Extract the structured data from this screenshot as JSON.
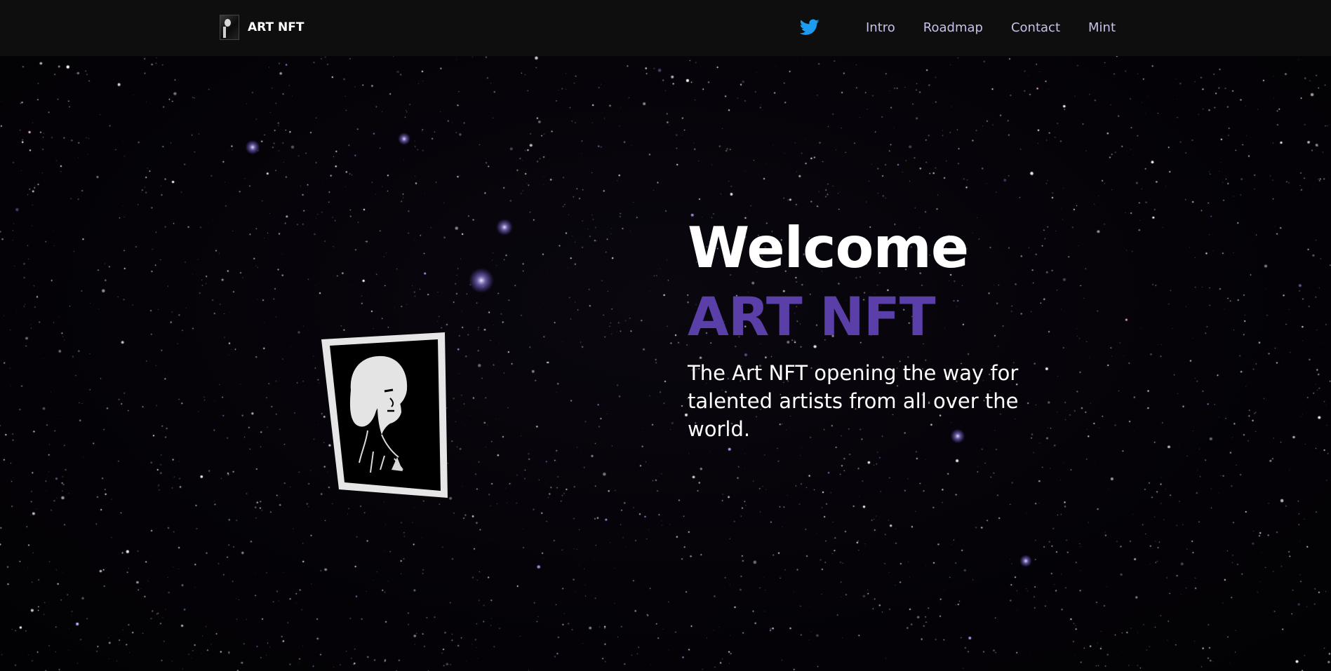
{
  "brand": {
    "name": "ART NFT",
    "logo_icon": "portrait-logo-icon"
  },
  "nav": {
    "twitter_icon": "twitter-icon",
    "twitter_color": "#1d9bf0",
    "links": [
      {
        "label": "Intro"
      },
      {
        "label": "Roadmap"
      },
      {
        "label": "Contact"
      },
      {
        "label": "Mint"
      }
    ]
  },
  "hero": {
    "title": "Welcome",
    "subtitle": "ART NFT",
    "subtitle_color": "#5a3fa8",
    "tagline": "The Art NFT opening the way for talented artists from all over the world.",
    "artwork_icon": "framed-portrait-icon"
  },
  "colors": {
    "navbar_bg": "#0e0e0e",
    "nav_link": "#c6c2ea",
    "background": "#000000"
  }
}
